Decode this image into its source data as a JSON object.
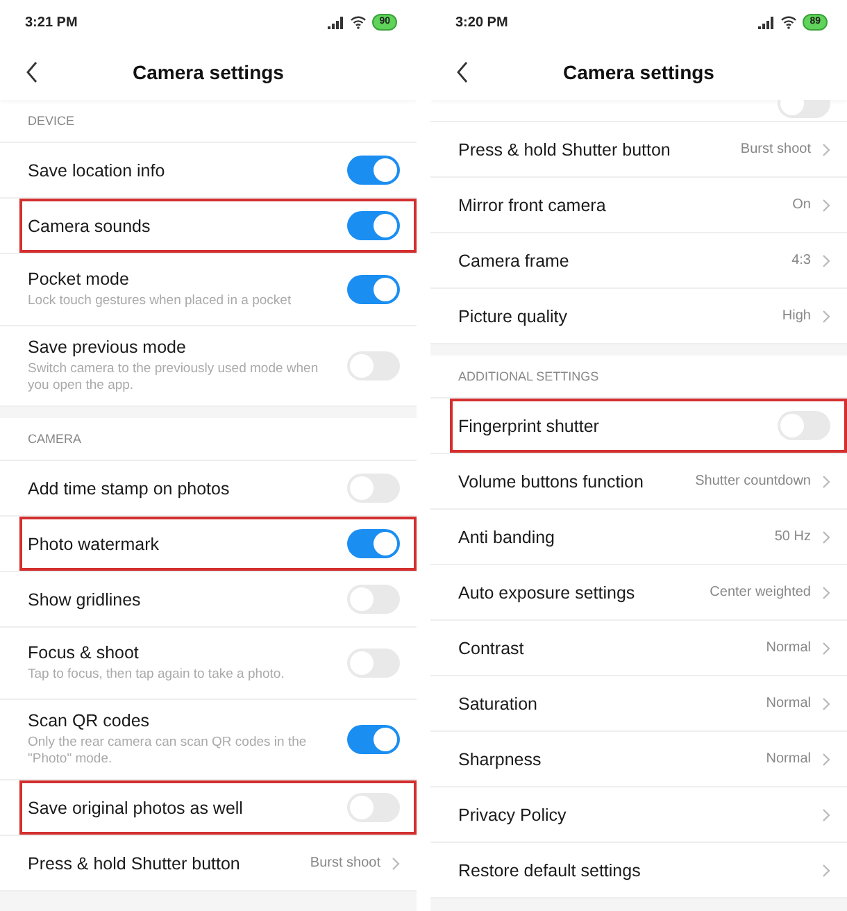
{
  "screens": [
    {
      "status_bar": {
        "time": "3:21 PM",
        "battery": "90"
      },
      "title": "Camera settings",
      "sections": [
        {
          "header": "DEVICE",
          "rows": [
            {
              "kind": "toggle",
              "label": "Save location info",
              "on": true,
              "highlighted": false
            },
            {
              "kind": "toggle",
              "label": "Camera sounds",
              "on": true,
              "highlighted": true
            },
            {
              "kind": "toggle",
              "label": "Pocket mode",
              "description": "Lock touch gestures when placed in a pocket",
              "on": true,
              "highlighted": false
            },
            {
              "kind": "toggle",
              "label": "Save previous mode",
              "description": "Switch camera to the previously used mode when you open the app.",
              "on": false,
              "highlighted": false
            }
          ]
        },
        {
          "header": "CAMERA",
          "rows": [
            {
              "kind": "toggle",
              "label": "Add time stamp on photos",
              "on": false,
              "highlighted": false
            },
            {
              "kind": "toggle",
              "label": "Photo watermark",
              "on": true,
              "highlighted": true
            },
            {
              "kind": "toggle",
              "label": "Show gridlines",
              "on": false,
              "highlighted": false
            },
            {
              "kind": "toggle",
              "label": "Focus & shoot",
              "description": "Tap to focus, then tap again to take a photo.",
              "on": false,
              "highlighted": false
            },
            {
              "kind": "toggle",
              "label": "Scan QR codes",
              "description": "Only the rear camera can scan QR codes in the \"Photo\" mode.",
              "on": true,
              "highlighted": false
            },
            {
              "kind": "toggle",
              "label": "Save original photos as well",
              "on": false,
              "highlighted": true
            },
            {
              "kind": "value",
              "label": "Press & hold Shutter button",
              "value": "Burst shoot",
              "highlighted": false
            }
          ]
        }
      ]
    },
    {
      "status_bar": {
        "time": "3:20 PM",
        "battery": "89"
      },
      "title": "Camera settings",
      "sections": [
        {
          "rows": [
            {
              "kind": "cut_toggle",
              "on": false
            },
            {
              "kind": "value",
              "label": "Press & hold Shutter button",
              "value": "Burst shoot",
              "highlighted": false
            },
            {
              "kind": "value",
              "label": "Mirror front camera",
              "value": "On",
              "highlighted": false
            },
            {
              "kind": "value",
              "label": "Camera frame",
              "value": "4:3",
              "highlighted": false
            },
            {
              "kind": "value",
              "label": "Picture quality",
              "value": "High",
              "highlighted": false
            }
          ]
        },
        {
          "header": "ADDITIONAL SETTINGS",
          "rows": [
            {
              "kind": "toggle",
              "label": "Fingerprint shutter",
              "on": false,
              "highlighted": true
            },
            {
              "kind": "value",
              "label": "Volume buttons function",
              "value": "Shutter countdown",
              "highlighted": false
            },
            {
              "kind": "value",
              "label": "Anti banding",
              "value": "50 Hz",
              "highlighted": false
            },
            {
              "kind": "value",
              "label": "Auto exposure settings",
              "value": "Center weighted",
              "highlighted": false
            },
            {
              "kind": "value",
              "label": "Contrast",
              "value": "Normal",
              "highlighted": false
            },
            {
              "kind": "value",
              "label": "Saturation",
              "value": "Normal",
              "highlighted": false
            },
            {
              "kind": "value",
              "label": "Sharpness",
              "value": "Normal",
              "highlighted": false
            },
            {
              "kind": "link",
              "label": "Privacy Policy",
              "highlighted": false
            },
            {
              "kind": "link",
              "label": "Restore default settings",
              "highlighted": false
            }
          ]
        }
      ]
    }
  ]
}
